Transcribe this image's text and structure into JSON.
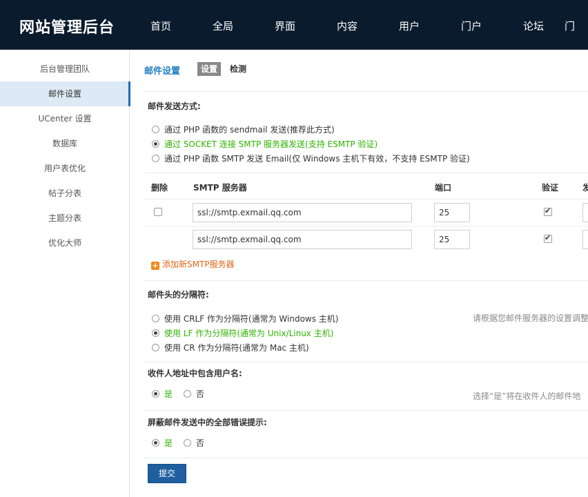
{
  "header": {
    "logo": "网站管理后台",
    "nav": [
      "首页",
      "全局",
      "界面",
      "内容",
      "用户",
      "门户",
      "论坛",
      "门"
    ]
  },
  "sidebar": {
    "items": [
      "后台管理团队",
      "邮件设置",
      "UCenter 设置",
      "数据库",
      "用户表优化",
      "帖子分表",
      "主题分表",
      "优化大师"
    ],
    "active_index": 1
  },
  "main": {
    "title": "邮件设置",
    "tabs": [
      "设置",
      "检测"
    ],
    "send_method": {
      "title": "邮件发送方式:",
      "options": [
        "通过 PHP 函数的 sendmail 发送(推荐此方式)",
        "通过 SOCKET 连接 SMTP 服务器发送(支持 ESMTP 验证)",
        "通过 PHP 函数 SMTP 发送 Email(仅 Windows 主机下有效，不支持 ESMTP 验证)"
      ],
      "selected": 1
    },
    "smtp_table": {
      "headers": [
        "删除",
        "SMTP 服务器",
        "端口",
        "验证",
        "发"
      ],
      "rows": [
        {
          "server": "ssl://smtp.exmail.qq.com",
          "port": "25",
          "auth": true,
          "deletable": true
        },
        {
          "server": "ssl://smtp.exmail.qq.com",
          "port": "25",
          "auth": true,
          "deletable": false
        }
      ],
      "add_label": "添加新SMTP服务器"
    },
    "separator": {
      "title": "邮件头的分隔符:",
      "options": [
        "使用 CRLF 作为分隔符(通常为 Windows 主机)",
        "使用 LF 作为分隔符(通常为 Unix/Linux 主机)",
        "使用 CR 作为分隔符(通常为 Mac 主机)"
      ],
      "selected": 1,
      "hint": "请根据您邮件服务器的设置调整"
    },
    "include_username": {
      "title": "收件人地址中包含用户名:",
      "yes": "是",
      "no": "否",
      "selected": "yes",
      "hint": "选择“是”将在收件人的邮件地"
    },
    "mute_errors": {
      "title": "屏蔽邮件发送中的全部错误提示:",
      "yes": "是",
      "no": "否",
      "selected": "yes"
    },
    "submit_label": "提交"
  }
}
